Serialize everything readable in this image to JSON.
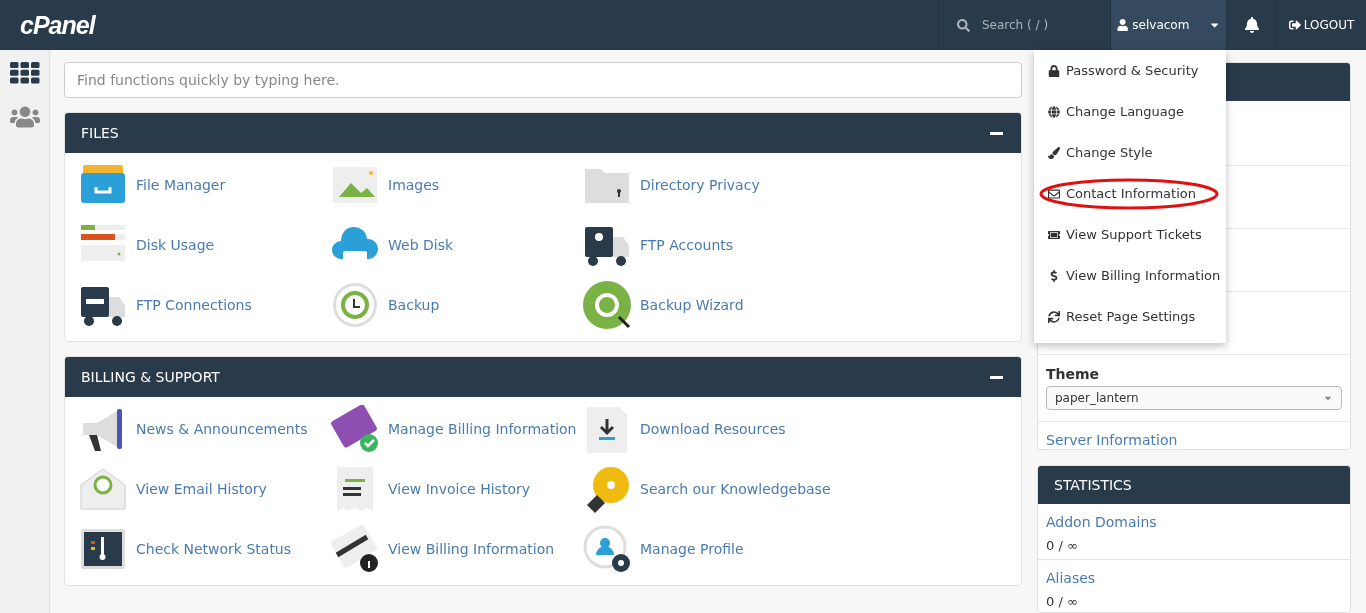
{
  "topbar": {
    "logo": "cPanel",
    "search": {
      "placeholder": "Search ( / )"
    },
    "user": {
      "name": "selvacom",
      "menu_open": true
    },
    "logout": "LOGOUT"
  },
  "quick_search": {
    "placeholder": "Find functions quickly by typing here."
  },
  "sections": [
    {
      "title": "FILES",
      "expanded": true,
      "items": [
        {
          "label": "File Manager"
        },
        {
          "label": "Images"
        },
        {
          "label": "Directory Privacy"
        },
        {
          "label": "Disk Usage"
        },
        {
          "label": "Web Disk"
        },
        {
          "label": "FTP Accounts"
        },
        {
          "label": "FTP Connections"
        },
        {
          "label": "Backup"
        },
        {
          "label": "Backup Wizard"
        }
      ]
    },
    {
      "title": "BILLING & SUPPORT",
      "expanded": true,
      "items": [
        {
          "label": "News & Announcements"
        },
        {
          "label": "Manage Billing Information"
        },
        {
          "label": "Download Resources"
        },
        {
          "label": "View Email History"
        },
        {
          "label": "View Invoice History"
        },
        {
          "label": "Search our Knowledgebase"
        },
        {
          "label": "Check Network Status"
        },
        {
          "label": "View Billing Information"
        },
        {
          "label": "Manage Profile"
        }
      ]
    }
  ],
  "user_menu": [
    {
      "label": "Password & Security",
      "highlighted": false
    },
    {
      "label": "Change Language",
      "highlighted": false
    },
    {
      "label": "Change Style",
      "highlighted": false
    },
    {
      "label": "Contact Information",
      "highlighted": true
    },
    {
      "label": "View Support Tickets",
      "highlighted": false
    },
    {
      "label": "View Billing Information",
      "highlighted": false
    },
    {
      "label": "Reset Page Settings",
      "highlighted": false
    }
  ],
  "info_panel": {
    "theme_label": "Theme",
    "theme_value": "paper_lantern",
    "link": "Server Information"
  },
  "statistics": {
    "title": "STATISTICS",
    "items": [
      {
        "label": "Addon Domains",
        "value": "0 / ∞"
      },
      {
        "label": "Aliases",
        "value": "0 / ∞"
      }
    ]
  }
}
